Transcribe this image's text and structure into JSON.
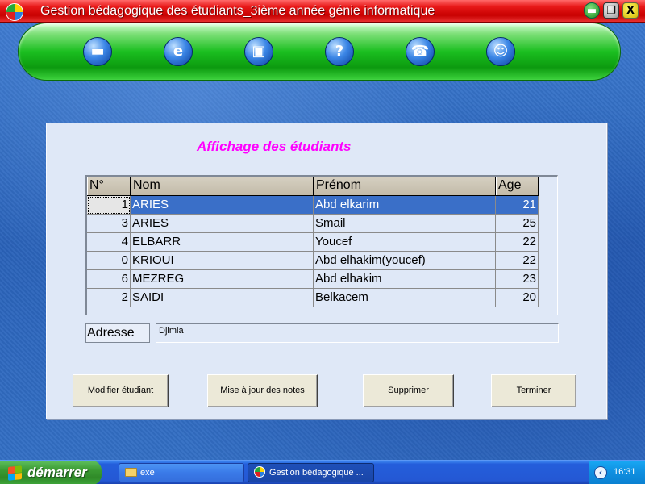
{
  "window": {
    "title": "Gestion bédagogique des étudiants_3ième année génie informatique",
    "minimize_glyph": "▬",
    "maximize_glyph": "❐",
    "close_glyph": "X"
  },
  "toolbar": {
    "icons": [
      "disk-icon",
      "internet-explorer-icon",
      "computer-icon",
      "help-icon",
      "headset-icon",
      "users-icon"
    ]
  },
  "main": {
    "heading": "Affichage des étudiants",
    "columns": [
      "N°",
      "Nom",
      "Prénom",
      "Age"
    ],
    "rows": [
      {
        "num": "1",
        "nom": "ARIES",
        "prenom": "Abd elkarim",
        "age": "21"
      },
      {
        "num": "3",
        "nom": "ARIES",
        "prenom": "Smail",
        "age": "25"
      },
      {
        "num": "4",
        "nom": "ELBARR",
        "prenom": "Youcef",
        "age": "22"
      },
      {
        "num": "0",
        "nom": "KRIOUI",
        "prenom": "Abd elhakim(youcef)",
        "age": "22"
      },
      {
        "num": "6",
        "nom": "MEZREG",
        "prenom": "Abd elhakim",
        "age": "23"
      },
      {
        "num": "2",
        "nom": "SAIDI",
        "prenom": "Belkacem",
        "age": "20"
      }
    ],
    "selected_row": 0,
    "address_label": "Adresse",
    "address_value": "Djimla",
    "buttons": {
      "modify": "Modifier étudiant",
      "update_grades": "Mise à jour des notes",
      "delete": "Supprimer",
      "finish": "Terminer"
    }
  },
  "taskbar": {
    "start_label": "démarrer",
    "items": [
      {
        "label": "exe",
        "icon": "folder-icon",
        "active": false
      },
      {
        "label": "Gestion bédagogique ...",
        "icon": "app-icon",
        "active": true
      }
    ],
    "tray_arrow": "‹",
    "clock": "16:31"
  },
  "colors": {
    "heading": "#ff00ff",
    "title_bar": "#e81a1a",
    "toolbar": "#1bbf20",
    "selection": "#3a6fc8",
    "panel": "#dfe8f7"
  }
}
